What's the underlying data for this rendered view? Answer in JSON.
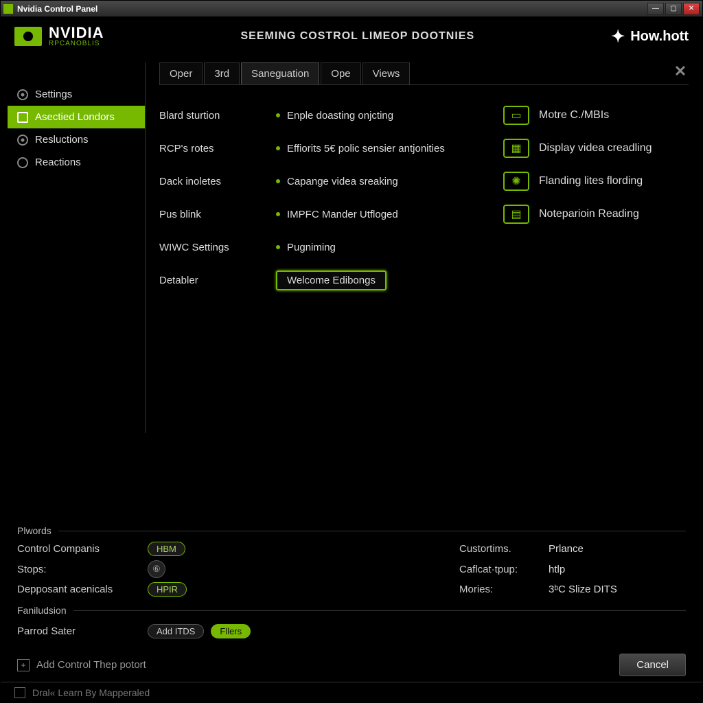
{
  "titlebar": {
    "title": "Nvidia Control Panel"
  },
  "header": {
    "brand": "NVIDIA",
    "sub": "RPCANOBLIS",
    "title": "SEEMING COSTROL LIMEOP DOOTNIES",
    "right": "How.hott"
  },
  "sidebar": {
    "items": [
      {
        "label": "Settings"
      },
      {
        "label": "Asectied Londors"
      },
      {
        "label": "Resluctions"
      },
      {
        "label": "Reactions"
      }
    ]
  },
  "tabs": {
    "items": [
      "Oper",
      "3rd",
      "Saneguation",
      "Ope",
      "Views"
    ],
    "active_index": 2
  },
  "options": {
    "labels": [
      "Blard sturtion",
      "RCP's rotes",
      "Dack inoletes",
      "Pus blink",
      "WIWC Settings",
      "Detabler"
    ],
    "bullets": [
      "Enple doasting onjcting",
      "Effiorits 5€ polic sensier antjonities",
      "Capange videa sreaking",
      "IMPFC Mander Utfloged",
      "Pugniming"
    ],
    "welcome": "Welcome Edibongs",
    "cards": [
      {
        "label": "Motre C./MBIs"
      },
      {
        "label": "Display videa creadling"
      },
      {
        "label": "Flanding lites flording"
      },
      {
        "label": "Noteparioin Reading"
      }
    ]
  },
  "lower": {
    "section1": "Plwords",
    "section2": "Faniludsion",
    "rows": {
      "r1l": "Control Companis",
      "r1v": "HBM",
      "r2l": "Stops:",
      "r3l": "Depposant acenicals",
      "r3v": "HPIR",
      "r1rl": "Custortims.",
      "r1rv": "Prlance",
      "r2rl": "Caflcat·tpup:",
      "r2rv": "htlp",
      "r3rl": "Mories:",
      "r3rv": "3ᵇC Slize DITS"
    },
    "sater_label": "Parrod Sater",
    "add_btn": "Add ITDS",
    "files_btn": "Fllers"
  },
  "footer": {
    "add_control": "Add Control Thep potort",
    "cancel": "Cancel"
  },
  "status": {
    "text": "Dral« Learn By Mapperaled"
  }
}
